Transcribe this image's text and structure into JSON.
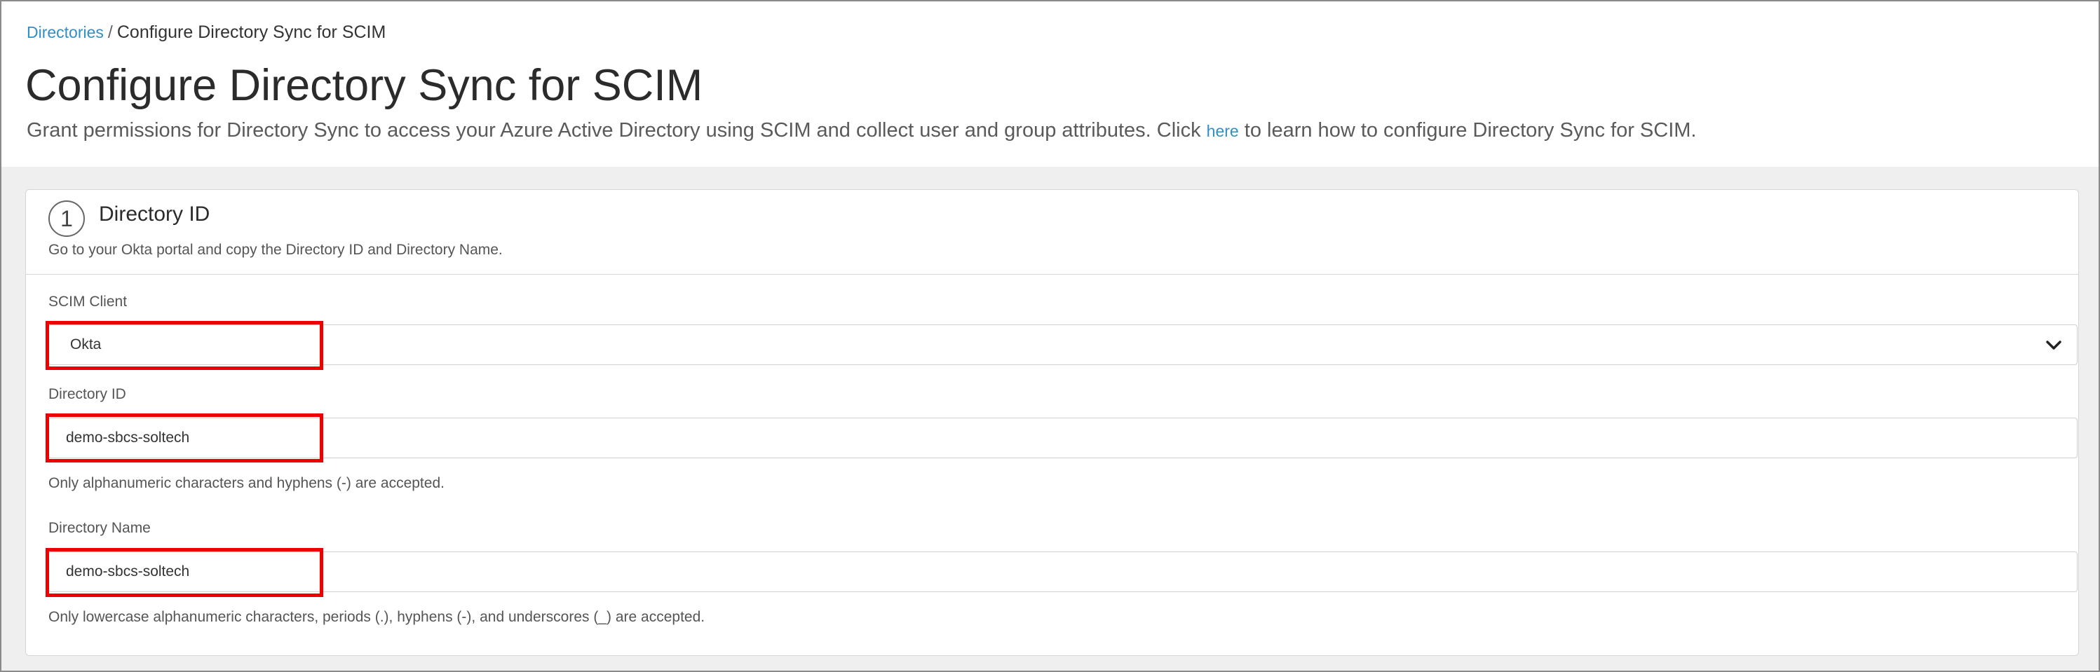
{
  "breadcrumb": {
    "parent": "Directories",
    "separator": "/",
    "current": "Configure Directory Sync for SCIM"
  },
  "page": {
    "title": "Configure Directory Sync for SCIM",
    "description_before": "Grant permissions for Directory Sync to access your Azure Active Directory using SCIM and collect user and group attributes. Click ",
    "link": "here",
    "description_after": " to learn how to configure Directory Sync for SCIM."
  },
  "step": {
    "number": "1",
    "title": "Directory ID",
    "subtitle": "Go to your Okta portal and copy the Directory ID and Directory Name."
  },
  "fields": {
    "scim_client": {
      "label": "SCIM Client",
      "value": "Okta"
    },
    "directory_id": {
      "label": "Directory ID",
      "value": "demo-sbcs-soltech",
      "help": "Only alphanumeric characters and hyphens (-) are accepted."
    },
    "directory_name": {
      "label": "Directory Name",
      "value": "demo-sbcs-soltech",
      "help": "Only lowercase alphanumeric characters, periods (.), hyphens (-), and underscores (_) are accepted."
    }
  },
  "colors": {
    "link": "#2f8fc7",
    "highlight": "#ee0000",
    "page_background": "#efefef"
  },
  "icons": {
    "select_arrow": "chevron-down-icon"
  }
}
